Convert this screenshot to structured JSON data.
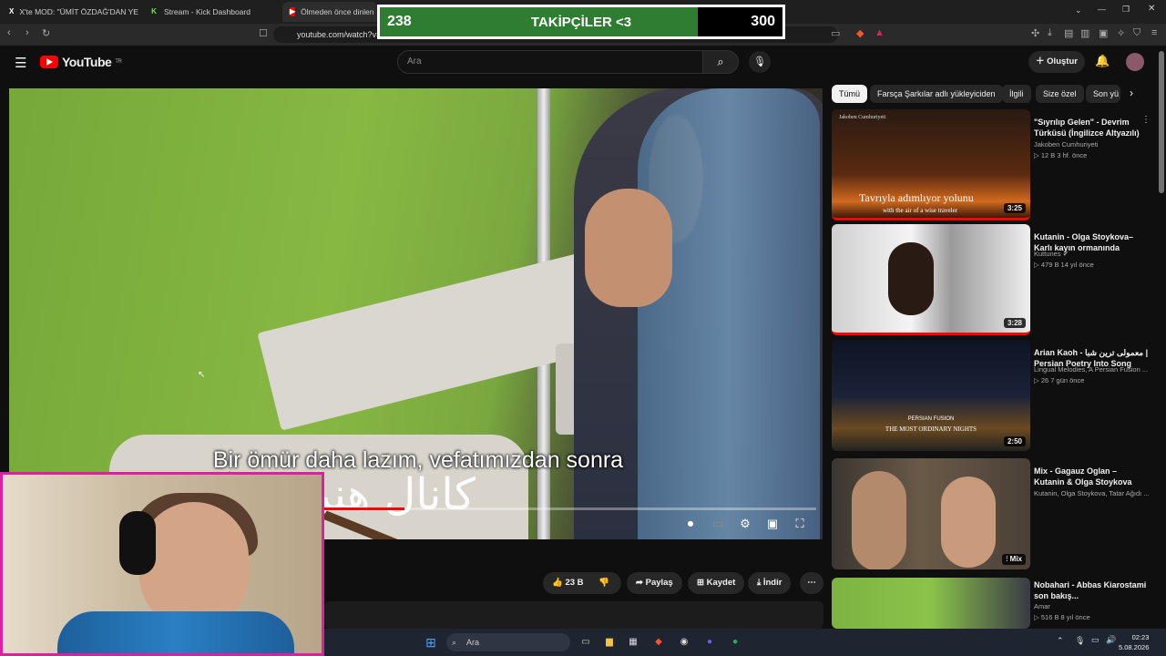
{
  "browser": {
    "tabs": [
      {
        "label": "X'te MOD: \"ÜMİT ÖZDAĞ'DAN YENİ",
        "icon": "x-logo-icon"
      },
      {
        "label": "Stream - Kick Dashboard",
        "icon": "kick-logo-icon"
      },
      {
        "label": "Ölmeden önce dinlen",
        "icon": "youtube-icon"
      }
    ],
    "url": "youtube.com/watch?v="
  },
  "overlay": {
    "current": "238",
    "label": "TAKİPÇİLER <3",
    "goal": "300",
    "progress_fraction": 0.79,
    "fill_color": "#2e7d32"
  },
  "youtube": {
    "logo_text": "YouTube",
    "region": "TR",
    "search_placeholder": "Ara",
    "create_label": "Oluştur"
  },
  "video": {
    "subtitle": "Bir ömür daha lazım, vefatımızdan sonra",
    "watermark": "کانال هنر",
    "progress_fraction": 0.48
  },
  "actions": {
    "likes": "23 B",
    "share": "Paylaş",
    "save": "Kaydet",
    "download": "İndir"
  },
  "chips": [
    "Tümü",
    "Farsça Şarkılar adlı yükleyiciden",
    "İlgili",
    "Size özel",
    "Son yü"
  ],
  "recommendations": [
    {
      "title": "\"Sıyrılıp Gelen\" - Devrim Türküsü (İngilizce Altyazılı)",
      "channel": "Jakoben Cumhuriyeti",
      "meta": "12 B   3 hf. önce",
      "duration": "3:25",
      "thumb_caption": "Tavrıyla adımlıyor yolunu",
      "thumb_subcaption": "with the air of a wise traveler",
      "thumb_channel": "Jakoben Cumhuriyeti"
    },
    {
      "title": "Kutanin - Olga Stoykova–Karlı kayın ormanında",
      "channel": "Kuttunes",
      "meta": "479 B   14 yıl önce",
      "duration": "3:28"
    },
    {
      "title": "Arian Kaoh - معمولی ترین شبا | Persian Poetry Into Song",
      "channel": "Lingual Melodies, A Persian Fusion ...",
      "meta": "26   7 gün önce",
      "duration": "2:50",
      "thumb_caption": "PERSIAN FUSION",
      "thumb_subcaption": "THE MOST ORDINARY NIGHTS"
    },
    {
      "title": "Mix - Gagauz Oglan – Kutanin & Olga Stoykova",
      "channel": "Kutanin, Olga Stoykova, Tatar Ağıdı ...",
      "meta": "",
      "duration": "Mix"
    },
    {
      "title": "Nobahari - Abbas Kiarostami son bakış...",
      "channel": "Amar",
      "meta": "516 B   8 yıl önce",
      "duration": ""
    }
  ],
  "taskbar": {
    "search": "Ara",
    "time": "02:23",
    "date": "5.08.2026"
  }
}
